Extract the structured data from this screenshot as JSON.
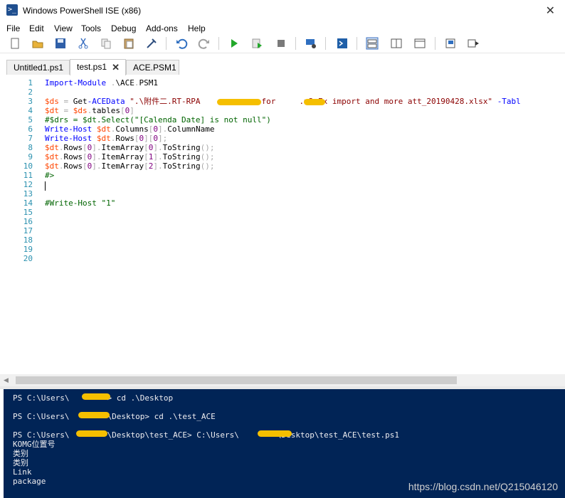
{
  "window": {
    "title": "Windows PowerShell ISE (x86)",
    "icon": "powershell-icon",
    "close": "✕"
  },
  "menu": [
    "File",
    "Edit",
    "View",
    "Tools",
    "Debug",
    "Add-ons",
    "Help"
  ],
  "toolbar": {
    "buttons": [
      "new-icon",
      "open-icon",
      "save-icon",
      "cut-icon",
      "copy-icon",
      "paste-icon",
      "clear-icon",
      "undo-icon",
      "redo-icon",
      "run-icon",
      "run-selection-icon",
      "stop-icon",
      "remote-icon",
      "powershell-icon",
      "layout-top-icon",
      "layout-right-icon",
      "layout-max-icon",
      "addon-icon",
      "show-command-icon"
    ]
  },
  "tabs": [
    {
      "label": "Untitled1.ps1",
      "active": false
    },
    {
      "label": "test.ps1",
      "active": true,
      "close": "✕"
    },
    {
      "label": "ACE.PSM1",
      "active": false
    }
  ],
  "editor": {
    "line_numbers": [
      "1",
      "2",
      "3",
      "4",
      "5",
      "6",
      "7",
      "8",
      "9",
      "10",
      "11",
      "12",
      "13",
      "14",
      "15",
      "16",
      "17",
      "18",
      "19",
      "20"
    ],
    "lines": [
      "Import-Module .\\ACE.PSM1",
      "",
      "$ds = Get-ACEData \".\\附件二.RT-RPA             for     .v3.Ex import and more att_20190428.xlsx\" -Tabl",
      "$dt = $ds.tables[0]",
      "#$drs = $dt.Select(\"[Calenda Date] is not null\")",
      "Write-Host $dt.Columns[0].ColumnName",
      "Write-Host $dt.Rows[0][0];",
      "$dt.Rows[0].ItemArray[0].ToString();",
      "$dt.Rows[0].ItemArray[1].ToString();",
      "$dt.Rows[0].ItemArray[2].ToString();",
      "#>",
      "",
      "",
      "#Write-Host \"1\"",
      "",
      "",
      "",
      "",
      "",
      ""
    ]
  },
  "console": {
    "lines": [
      "PS C:\\Users\\        > cd .\\Desktop",
      "",
      "PS C:\\Users\\        \\Desktop> cd .\\test_ACE",
      "",
      "PS C:\\Users\\        \\Desktop\\test_ACE> C:\\Users\\        \\Desktop\\test_ACE\\test.ps1",
      "KOMG位置号",
      "类别",
      "类别",
      "Link",
      "package"
    ]
  },
  "watermark": "https://blog.csdn.net/Q215046120"
}
